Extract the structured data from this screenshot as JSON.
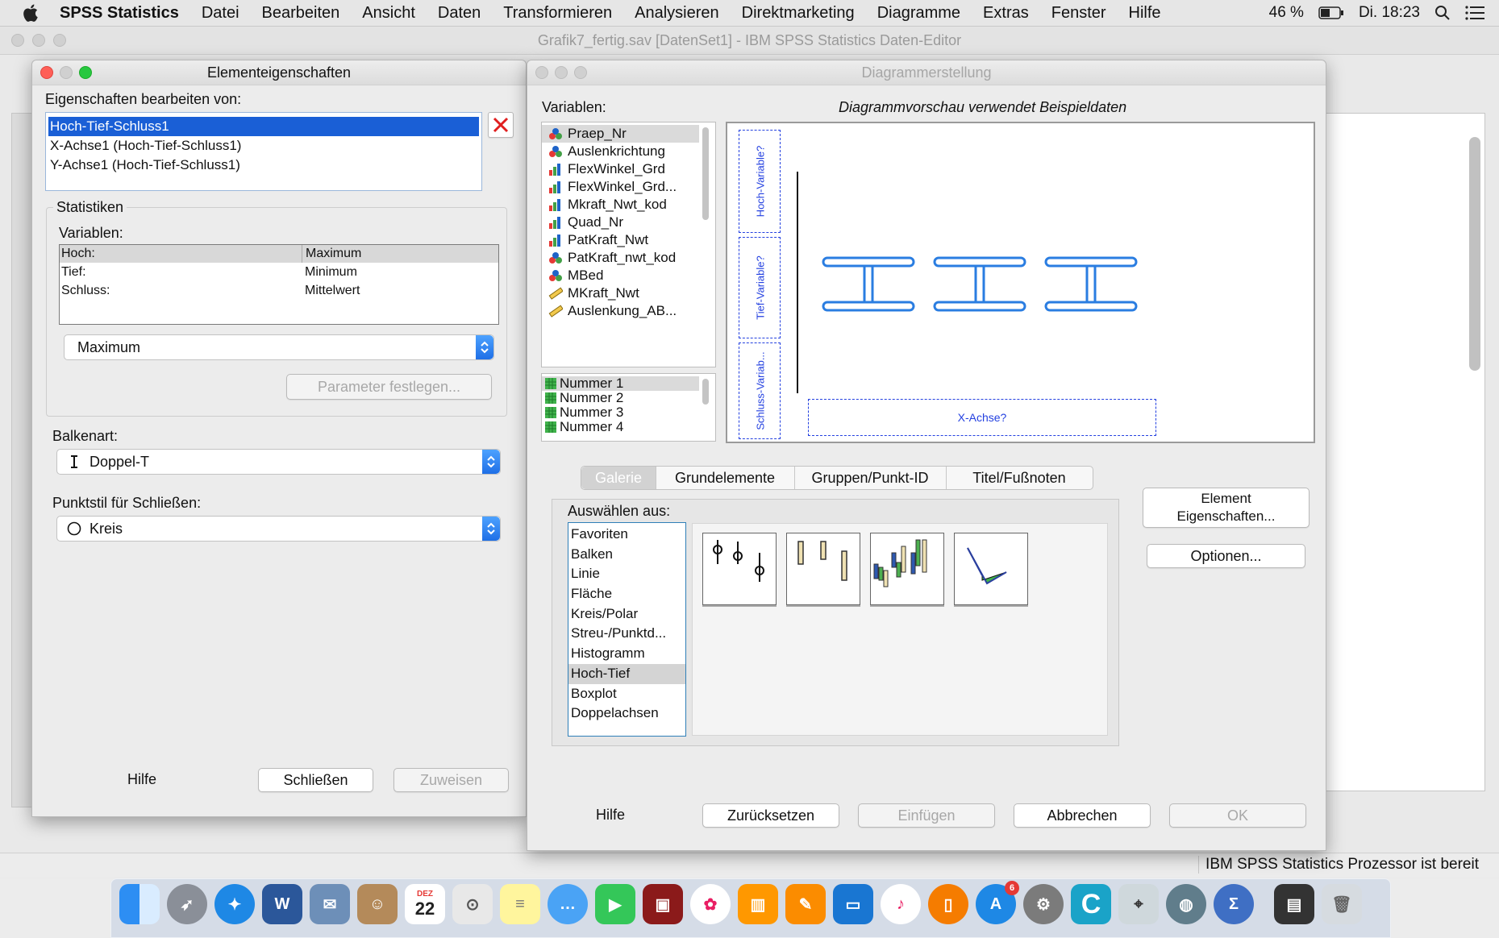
{
  "menubar": {
    "app": "SPSS Statistics",
    "items": [
      "Datei",
      "Bearbeiten",
      "Ansicht",
      "Daten",
      "Transformieren",
      "Analysieren",
      "Direktmarketing",
      "Diagramme",
      "Extras",
      "Fenster",
      "Hilfe"
    ],
    "battery": "46 %",
    "clock": "Di. 18:23"
  },
  "main_window": {
    "title": "Grafik7_fertig.sav [DatenSet1] - IBM SPSS Statistics Daten-Editor",
    "status": "IBM SPSS Statistics  Prozessor ist bereit"
  },
  "element_props": {
    "title": "Elementeigenschaften",
    "edit_label": "Eigenschaften bearbeiten von:",
    "edit_items": [
      "Hoch-Tief-Schluss1",
      "X-Achse1 (Hoch-Tief-Schluss1)",
      "Y-Achse1 (Hoch-Tief-Schluss1)"
    ],
    "stats_group": "Statistiken",
    "variables_label": "Variablen:",
    "stats_rows": [
      {
        "var": "Hoch:",
        "stat": "Maximum"
      },
      {
        "var": "Tief:",
        "stat": "Minimum"
      },
      {
        "var": "Schluss:",
        "stat": "Mittelwert"
      }
    ],
    "stat_select": "Maximum",
    "param_button": "Parameter festlegen...",
    "bar_type_label": "Balkenart:",
    "bar_type_value": "Doppel-T",
    "point_style_label": "Punktstil für Schließen:",
    "point_style_value": "Kreis",
    "help": "Hilfe",
    "close": "Schließen",
    "apply": "Zuweisen"
  },
  "chart_builder": {
    "title": "Diagrammerstellung",
    "variables_label": "Variablen:",
    "preview_label": "Diagrammvorschau verwendet Beispieldaten",
    "variables": [
      {
        "name": "Praep_Nr",
        "icon": "nominal-icon"
      },
      {
        "name": "Auslenkrichtung",
        "icon": "nominal-icon"
      },
      {
        "name": "FlexWinkel_Grd",
        "icon": "ordinal-icon"
      },
      {
        "name": "FlexWinkel_Grd...",
        "icon": "ordinal-icon"
      },
      {
        "name": "Mkraft_Nwt_kod",
        "icon": "ordinal-icon"
      },
      {
        "name": "Quad_Nr",
        "icon": "ordinal-icon"
      },
      {
        "name": "PatKraft_Nwt",
        "icon": "ordinal-icon"
      },
      {
        "name": "PatKraft_nwt_kod",
        "icon": "nominal-icon"
      },
      {
        "name": "MBed",
        "icon": "nominal-icon"
      },
      {
        "name": "MKraft_Nwt",
        "icon": "scale-icon"
      },
      {
        "name": "Auslenkung_AB...",
        "icon": "scale-icon"
      }
    ],
    "categories": [
      "Nummer 1",
      "Nummer 2",
      "Nummer 3",
      "Nummer 4"
    ],
    "drop_zones": {
      "high": "Hoch-Variable?",
      "low": "Tief-Variable?",
      "close": "Schluss-Variab...",
      "x": "X-Achse?"
    },
    "tabs": [
      "Galerie",
      "Grundelemente",
      "Gruppen/Punkt-ID",
      "Titel/Fußnoten"
    ],
    "choose_from": "Auswählen aus:",
    "gallery_types": [
      "Favoriten",
      "Balken",
      "Linie",
      "Fläche",
      "Kreis/Polar",
      "Streu-/Punktd...",
      "Histogramm",
      "Hoch-Tief",
      "Boxplot",
      "Doppelachsen"
    ],
    "selected_type": "Hoch-Tief",
    "element_props_button": [
      "Element",
      "Eigenschaften..."
    ],
    "options_button": "Optionen...",
    "help": "Hilfe",
    "reset": "Zurücksetzen",
    "insert": "Einfügen",
    "cancel": "Abbrechen",
    "ok": "OK"
  },
  "dock": {
    "calendar_month": "DEZ",
    "calendar_day": "22",
    "badge": "6"
  },
  "colors": {
    "selection": "#1a5fd6",
    "accent_blue": "#2a7de1",
    "dropzone": "#2340e0"
  }
}
